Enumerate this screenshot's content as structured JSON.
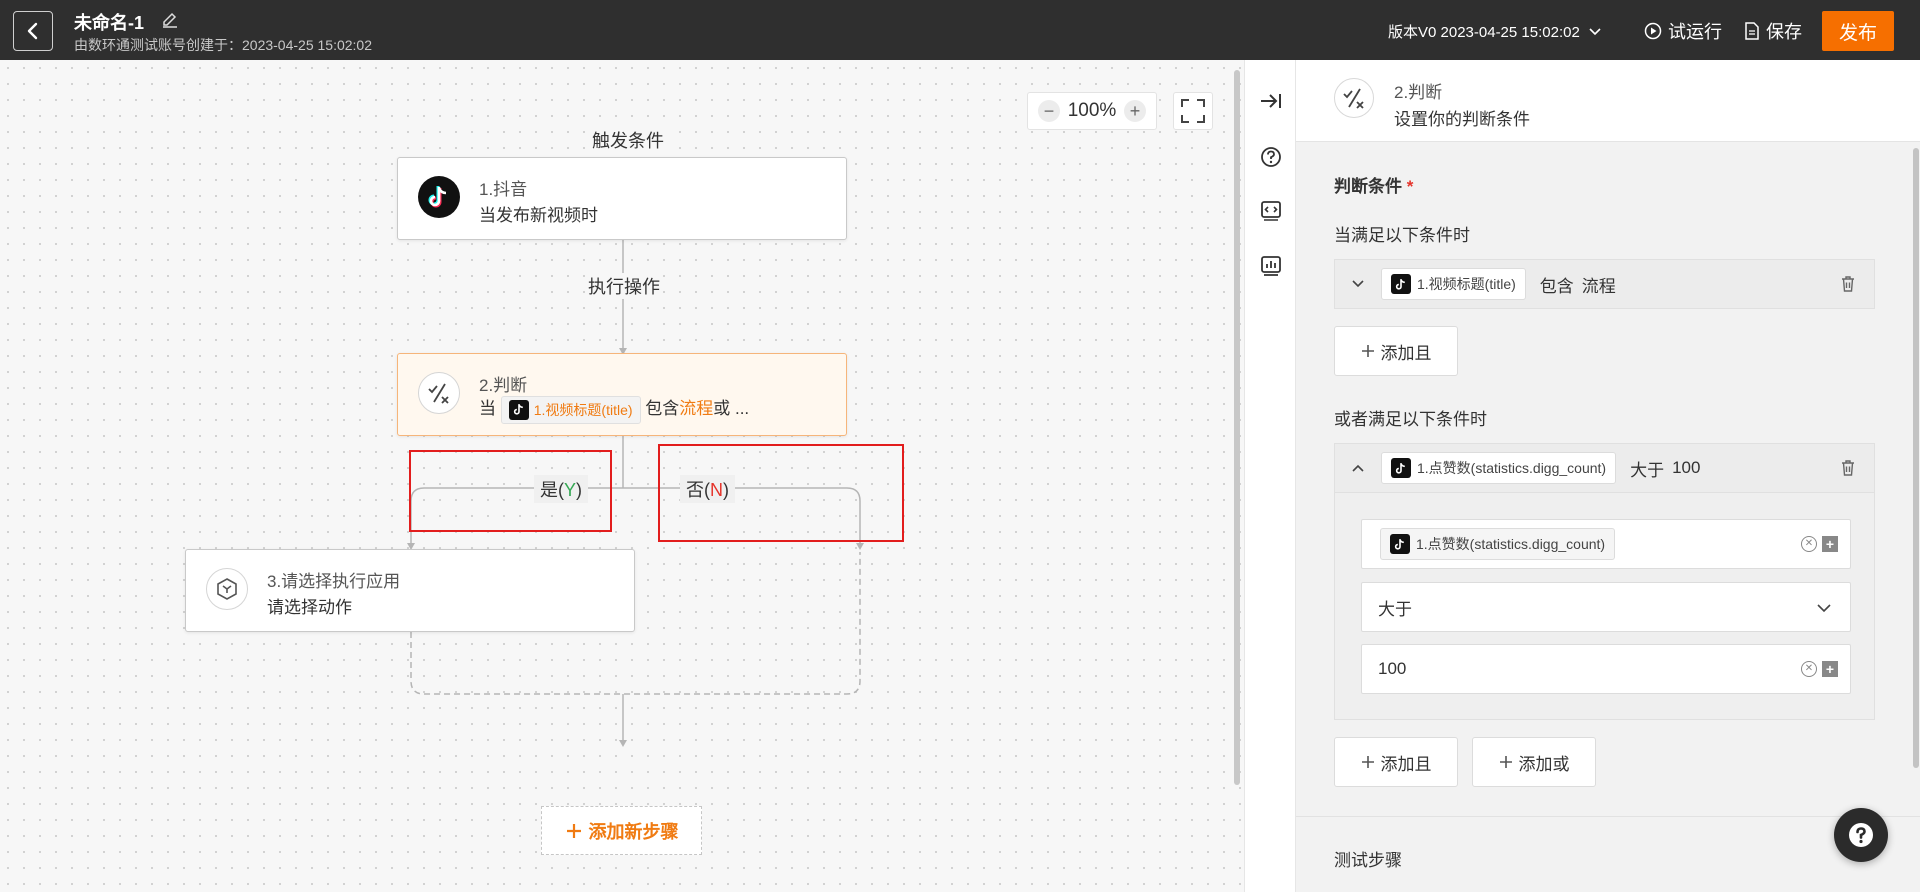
{
  "header": {
    "title": "未命名-1",
    "subtitle": "由数环通测试账号创建于：2023-04-25 15:02:02",
    "version_label": "版本V0 2023-04-25 15:02:02",
    "test_run_label": "试运行",
    "save_label": "保存",
    "publish_label": "发布"
  },
  "canvas": {
    "zoom": "100%",
    "trigger_label": "触发条件",
    "action_label": "执行操作",
    "node1": {
      "title": "1.抖音",
      "subtitle": "当发布新视频时"
    },
    "node2": {
      "title": "2.判断",
      "prefix": "当",
      "field": "1.视频标题(title)",
      "op": "包含",
      "keyword": "流程",
      "suffix": "或 ..."
    },
    "branch_yes": {
      "text": "是(",
      "key": "Y",
      "close": ")"
    },
    "branch_no": {
      "text": "否(",
      "key": "N",
      "close": ")"
    },
    "node3": {
      "title": "3.请选择执行应用",
      "subtitle": "请选择动作"
    },
    "add_step_label": "添加新步骤"
  },
  "panel": {
    "title": "2.判断",
    "subtitle": "设置你的判断条件",
    "section_label": "判断条件",
    "required_mark": "*",
    "group1_label": "当满足以下条件时",
    "group1_row": {
      "field": "1.视频标题(title)",
      "op": "包含",
      "value": "流程"
    },
    "add_and_label": "添加且",
    "group2_label": "或者满足以下条件时",
    "group2_row": {
      "field": "1.点赞数(statistics.digg_count)",
      "op": "大于",
      "value": "100"
    },
    "edit_field": "1.点赞数(statistics.digg_count)",
    "edit_op": "大于",
    "edit_value": "100",
    "add_and_label2": "添加且",
    "add_or_label": "添加或",
    "test_step_label": "测试步骤"
  },
  "colors": {
    "accent": "#f66f00",
    "header_bg": "#2f2f2f",
    "highlight_box": "#e21d1d"
  }
}
